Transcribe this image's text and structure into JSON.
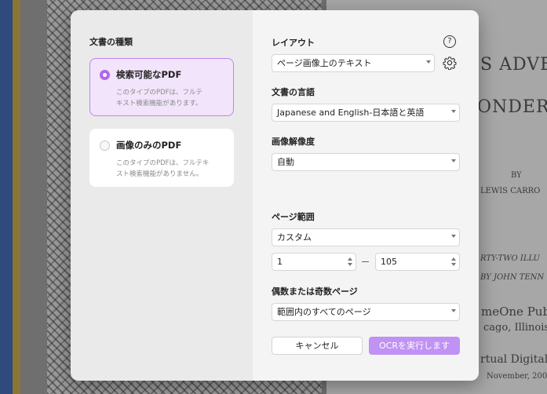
{
  "background": {
    "lines": [
      "S ADVEN",
      "ONDERL",
      "BY",
      "LEWIS CARRO",
      "RTY-TWO ILLU",
      "BY JOHN TENN",
      "meOne Pub",
      "cago, Illinois",
      "rtual Digital L",
      "November, 200"
    ]
  },
  "left": {
    "section_title": "文書の種類",
    "cards": [
      {
        "title": "検索可能なPDF",
        "desc_line1": "このタイプのPDFは、フルテ",
        "desc_line2": "キスト検索機能があります。",
        "selected": true
      },
      {
        "title": "画像のみのPDF",
        "desc_line1": "このタイプのPDFは、フルテキ",
        "desc_line2": "スト検索機能がありません。",
        "selected": false
      }
    ]
  },
  "right": {
    "layout_label": "レイアウト",
    "layout_value": "ページ画像上のテキスト",
    "language_label": "文書の言語",
    "language_value": "Japanese and English-日本語と英語",
    "resolution_label": "画像解像度",
    "resolution_value": "自動",
    "page_range_label": "ページ範囲",
    "page_range_value": "カスタム",
    "range_from": "1",
    "range_to": "105",
    "odd_even_label": "偶数または奇数ページ",
    "odd_even_value": "範囲内のすべてのページ",
    "cancel_label": "キャンセル",
    "run_label": "OCRを実行します",
    "help_glyph": "?"
  },
  "colors": {
    "accent": "#b267ee",
    "primary_button": "#c092f4",
    "selected_card_bg": "#f1e4fb"
  }
}
